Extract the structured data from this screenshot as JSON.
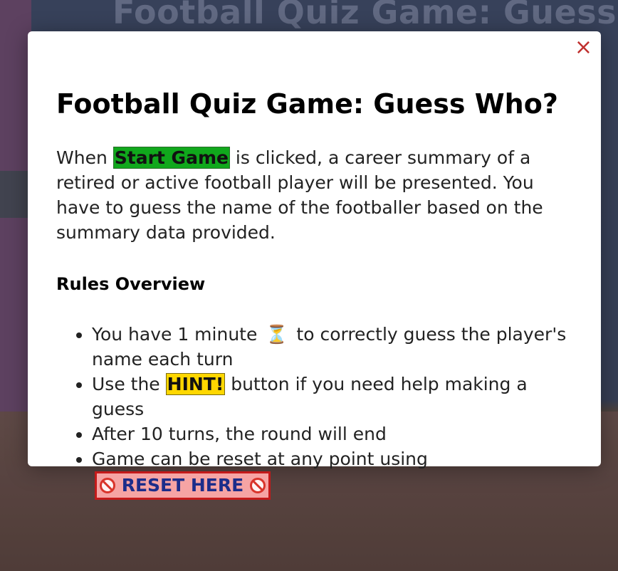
{
  "background": {
    "title": "Football Quiz Game: Guess W"
  },
  "modal": {
    "close_icon": "×",
    "title": "Football Quiz Game: Guess Who?",
    "intro": {
      "before": "When ",
      "start_label": "Start Game",
      "after": " is clicked, a career summary of a retired or active football player will be presented. You have to guess the name of the footballer based on the summary data provided."
    },
    "rules_heading": "Rules Overview",
    "rules": {
      "r1_before": "You have 1 minute",
      "r1_icon": "⏳",
      "r1_after": "to correctly guess the player's name each turn",
      "r2_before": "Use the ",
      "r2_hint": "HINT!",
      "r2_after": " button if you need help making a guess",
      "r3": "After 10 turns, the round will end",
      "r4_before": "Game can be reset at any point using",
      "r4_reset": "RESET HERE"
    }
  },
  "colors": {
    "start_highlight": "#10a81c",
    "hint_highlight": "#ffd700",
    "reset_bg": "#f6a4a4",
    "reset_border": "#c41a1a",
    "reset_text": "#1c2d8a",
    "close_icon": "#c0312f"
  },
  "icons": {
    "close": "close-icon",
    "hourglass": "hourglass-icon",
    "no_entry": "no-entry-icon"
  }
}
